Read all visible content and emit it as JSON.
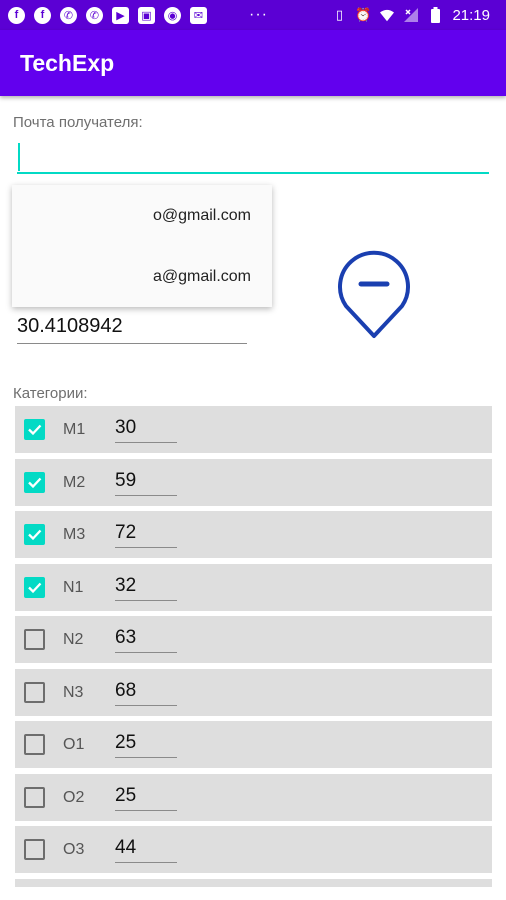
{
  "status_bar": {
    "time": "21:19",
    "dots": "···",
    "left_icons": [
      "facebook-icon",
      "facebook-icon",
      "whatsapp-icon",
      "whatsapp-icon",
      "video-call-icon",
      "image-icon",
      "circle-icon",
      "mail-icon"
    ],
    "right_icons": [
      "vibrate-icon",
      "alarm-icon",
      "wifi-icon",
      "no-signal-icon",
      "battery-icon"
    ]
  },
  "app_bar": {
    "title": "TechExp"
  },
  "recipient": {
    "label": "Почта получателя:",
    "value": ""
  },
  "suggestions": [
    "o@gmail.com",
    "a@gmail.com"
  ],
  "coordinate_value": "30.4108942",
  "categories": {
    "label": "Категории:",
    "items": [
      {
        "name": "M1",
        "value": "30",
        "checked": true
      },
      {
        "name": "M2",
        "value": "59",
        "checked": true
      },
      {
        "name": "M3",
        "value": "72",
        "checked": true
      },
      {
        "name": "N1",
        "value": "32",
        "checked": true
      },
      {
        "name": "N2",
        "value": "63",
        "checked": false
      },
      {
        "name": "N3",
        "value": "68",
        "checked": false
      },
      {
        "name": "O1",
        "value": "25",
        "checked": false
      },
      {
        "name": "O2",
        "value": "25",
        "checked": false
      },
      {
        "name": "O3",
        "value": "44",
        "checked": false
      }
    ]
  },
  "colors": {
    "status_bar": "#5b00d4",
    "app_bar": "#6200ee",
    "accent": "#03dac5",
    "pin": "#1a3fb0",
    "row_background": "#dedede"
  }
}
